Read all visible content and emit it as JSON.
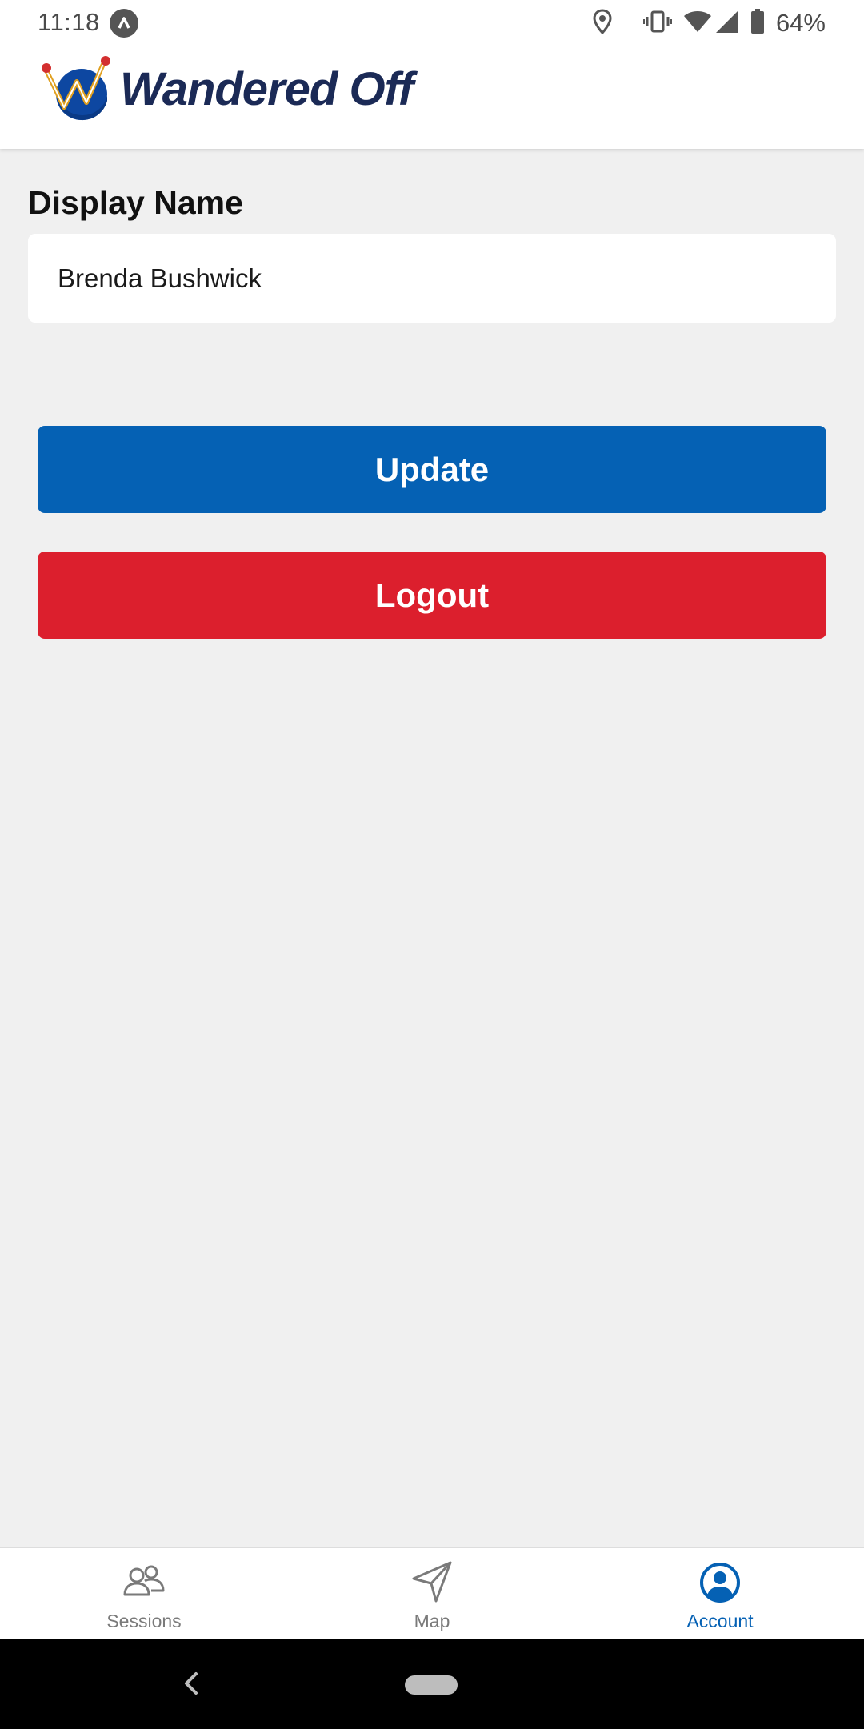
{
  "status_bar": {
    "time": "11:18",
    "battery_percent": "64%",
    "icons": [
      "app-notification-icon",
      "location-icon",
      "vibrate-icon",
      "wifi-icon",
      "cell-signal-icon",
      "battery-icon"
    ]
  },
  "header": {
    "brand_name": "Wandered Off"
  },
  "form": {
    "display_name_label": "Display Name",
    "display_name_value": "Brenda Bushwick"
  },
  "actions": {
    "update_label": "Update",
    "logout_label": "Logout"
  },
  "bottom_nav": {
    "items": [
      {
        "label": "Sessions",
        "icon": "people-icon",
        "active": false
      },
      {
        "label": "Map",
        "icon": "navigation-arrow-icon",
        "active": false
      },
      {
        "label": "Account",
        "icon": "account-circle-icon",
        "active": true
      }
    ]
  },
  "colors": {
    "primary_blue": "#0561b4",
    "logout_red": "#dc1f2d",
    "brand_navy": "#1b2a56",
    "background": "#f0f0f0"
  }
}
